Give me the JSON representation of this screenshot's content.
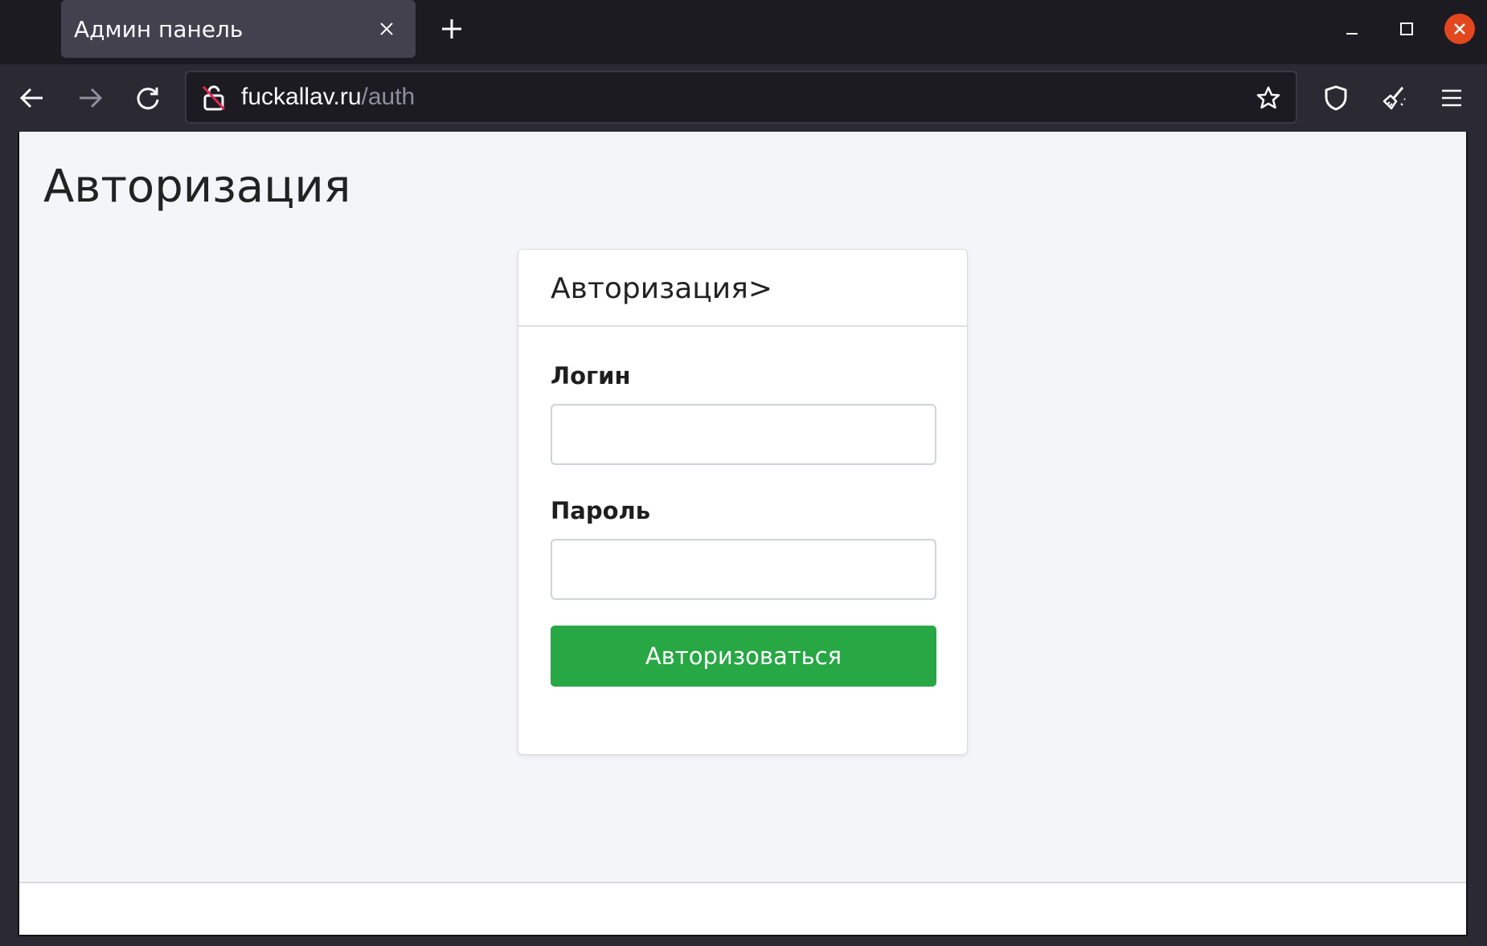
{
  "browser": {
    "tab_title": "Админ панель",
    "url_host": "fuckallav.ru",
    "url_path": "/auth"
  },
  "page": {
    "title": "Авторизация"
  },
  "auth_card": {
    "header": "Авторизация>",
    "login_label": "Логин",
    "login_value": "",
    "password_label": "Пароль",
    "password_value": "",
    "submit_label": "Авторизоваться"
  },
  "colors": {
    "submit_button": "#28a745",
    "window_close": "#e2471e",
    "page_background": "#f4f5f9"
  },
  "icons": [
    "close-icon",
    "plus-icon",
    "minimize-icon",
    "maximize-icon",
    "back-arrow-icon",
    "forward-arrow-icon",
    "reload-icon",
    "insecure-lock-icon",
    "star-icon",
    "shield-icon",
    "broom-icon",
    "hamburger-menu-icon"
  ]
}
